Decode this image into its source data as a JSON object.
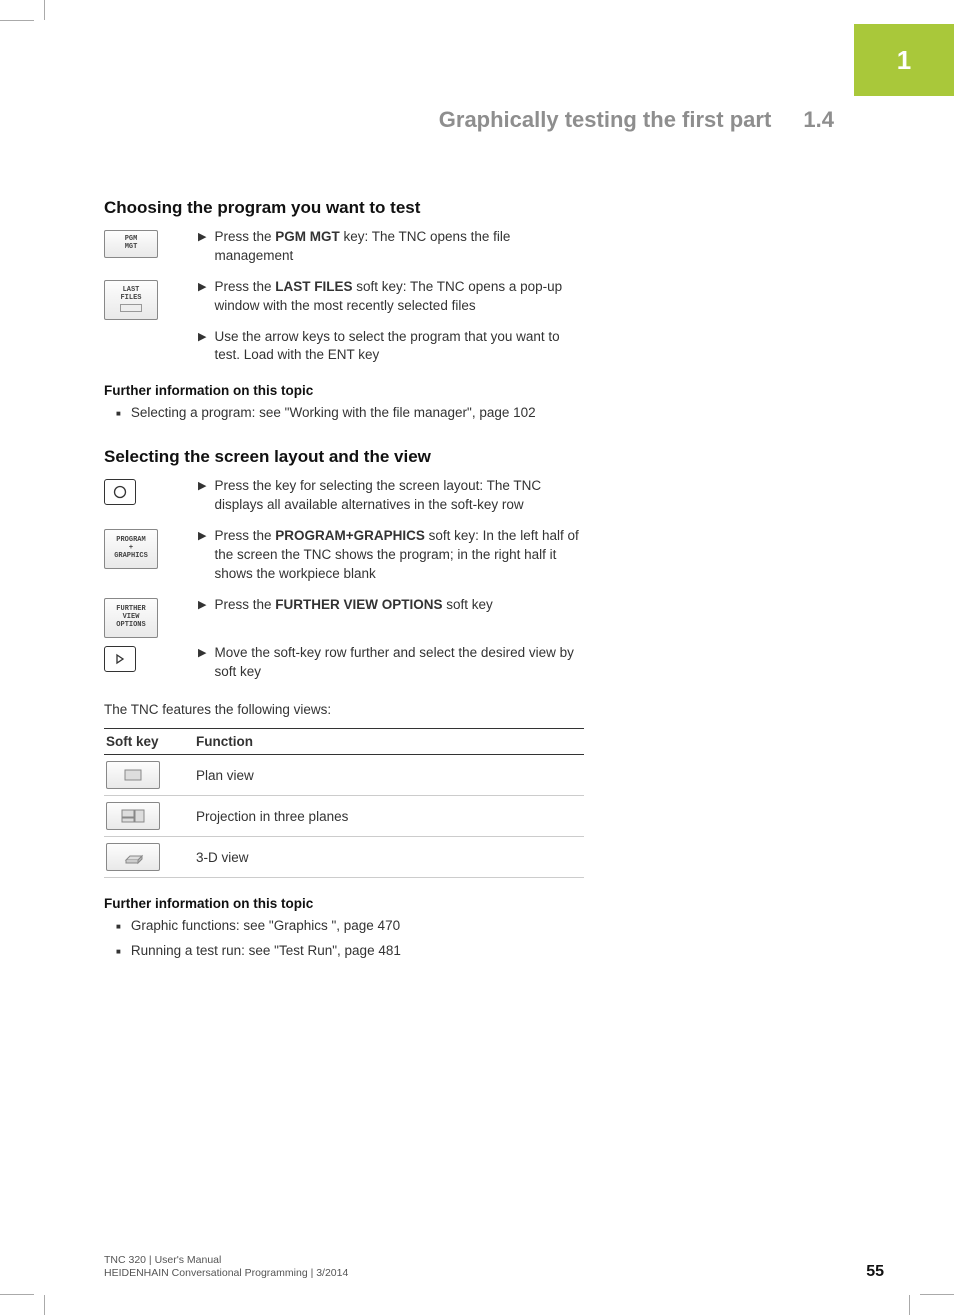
{
  "chapter_num": "1",
  "running_title": "Graphically testing the first part",
  "running_num": "1.4",
  "section1": {
    "heading": "Choosing the program you want to test",
    "step1": {
      "key": "PGM\nMGT",
      "pre": "Press the ",
      "bold": "PGM MGT",
      "post": " key: The TNC opens the file management"
    },
    "step2": {
      "key": "LAST\nFILES",
      "pre": "Press the ",
      "bold": "LAST FILES",
      "post": " soft key: The TNC opens a pop-up window with the most recently selected files"
    },
    "step3": {
      "text": "Use the arrow keys to select the program that you want to test. Load with the ENT key"
    },
    "further_label": "Further information on this topic",
    "further1": "Selecting a program: see \"Working with the file manager\", page 102"
  },
  "section2": {
    "heading": "Selecting the screen layout and the view",
    "step1": {
      "text": "Press the key for selecting the screen layout: The TNC displays all available alternatives in the soft-key row"
    },
    "step2": {
      "key": "PROGRAM\n+\nGRAPHICS",
      "pre": "Press the ",
      "bold": "PROGRAM+GRAPHICS",
      "post": " soft key: In the left half of the screen the TNC shows the program; in the right half it shows the workpiece blank"
    },
    "step3": {
      "key": "FURTHER\nVIEW\nOPTIONS",
      "pre": "Press the ",
      "bold": "FURTHER VIEW OPTIONS",
      "post": " soft key"
    },
    "step4": {
      "text": "Move the soft-key row further and select the desired view by soft key"
    },
    "intro_views": "The TNC features the following views:",
    "table": {
      "h1": "Soft key",
      "h2": "Function",
      "r1": "Plan view",
      "r2": "Projection in three planes",
      "r3": "3-D view"
    },
    "further_label": "Further information on this topic",
    "further1": "Graphic functions: see \"Graphics \", page 470",
    "further2": "Running a test run: see \"Test Run\", page 481"
  },
  "footer": {
    "line1": "TNC 320 | User's Manual",
    "line2": "HEIDENHAIN Conversational Programming | 3/2014",
    "page": "55"
  }
}
